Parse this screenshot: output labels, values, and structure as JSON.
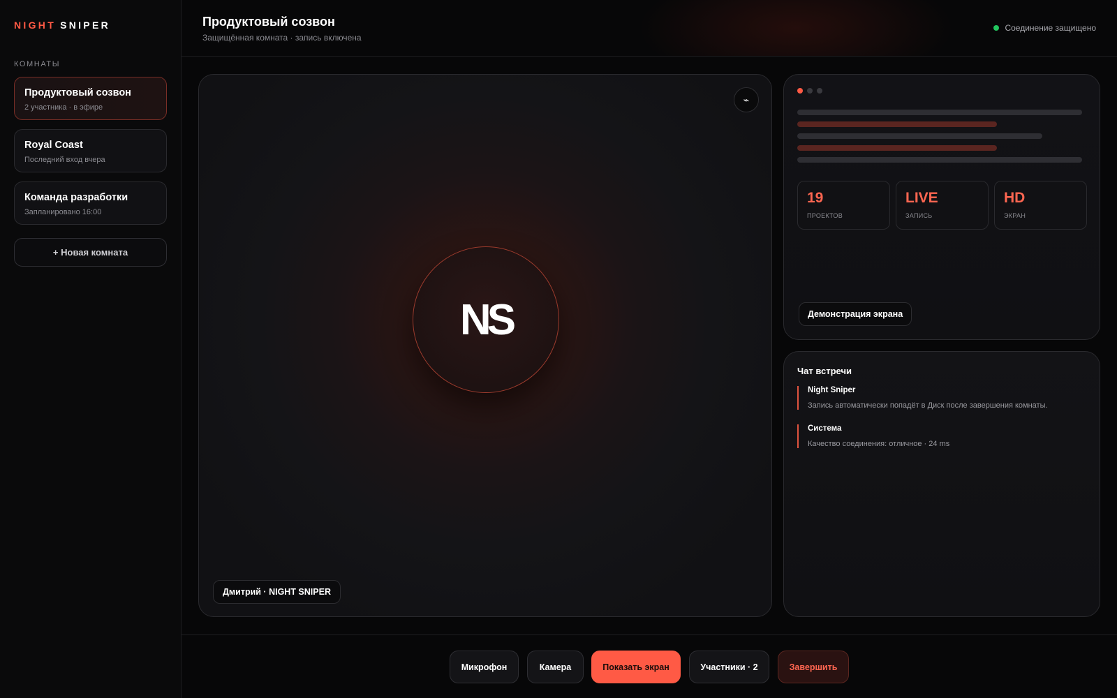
{
  "brand": {
    "part1": "NIGHT",
    "part2": "SNIPER"
  },
  "sidebar": {
    "section_title": "КОМНАТЫ",
    "rooms": [
      {
        "name": "Продуктовый созвон",
        "sub": "2 участника · в эфире",
        "active": true
      },
      {
        "name": "Royal Coast",
        "sub": "Последний вход вчера",
        "active": false
      },
      {
        "name": "Команда разработки",
        "sub": "Запланировано 16:00",
        "active": false
      }
    ],
    "new_room_label": "+ Новая комната"
  },
  "header": {
    "title": "Продуктовый созвон",
    "subtitle": "Защищённая комната · запись включена",
    "status": "Соединение защищено",
    "status_color": "#22c55e"
  },
  "video": {
    "avatar_initials": "NS",
    "participant_label": "Дмитрий · NIGHT SNIPER",
    "pin_icon": "⌁"
  },
  "screen_share": {
    "stats": [
      {
        "value": "19",
        "label": "ПРОЕКТОВ"
      },
      {
        "value": "LIVE",
        "label": "ЗАПИСЬ"
      },
      {
        "value": "HD",
        "label": "ЭКРАН"
      }
    ],
    "label": "Демонстрация экрана"
  },
  "chat": {
    "title": "Чат встречи",
    "messages": [
      {
        "author": "Night Sniper",
        "text": "Запись автоматически попадёт в Диск после завершения комнаты."
      },
      {
        "author": "Система",
        "text": "Качество соединения: отличное · 24 ms"
      }
    ]
  },
  "toolbar": {
    "mic": "Микрофон",
    "camera": "Камера",
    "share": "Показать экран",
    "participants": "Участники · 2",
    "end": "Завершить"
  },
  "colors": {
    "accent": "#ff5a45",
    "background": "#070708"
  }
}
